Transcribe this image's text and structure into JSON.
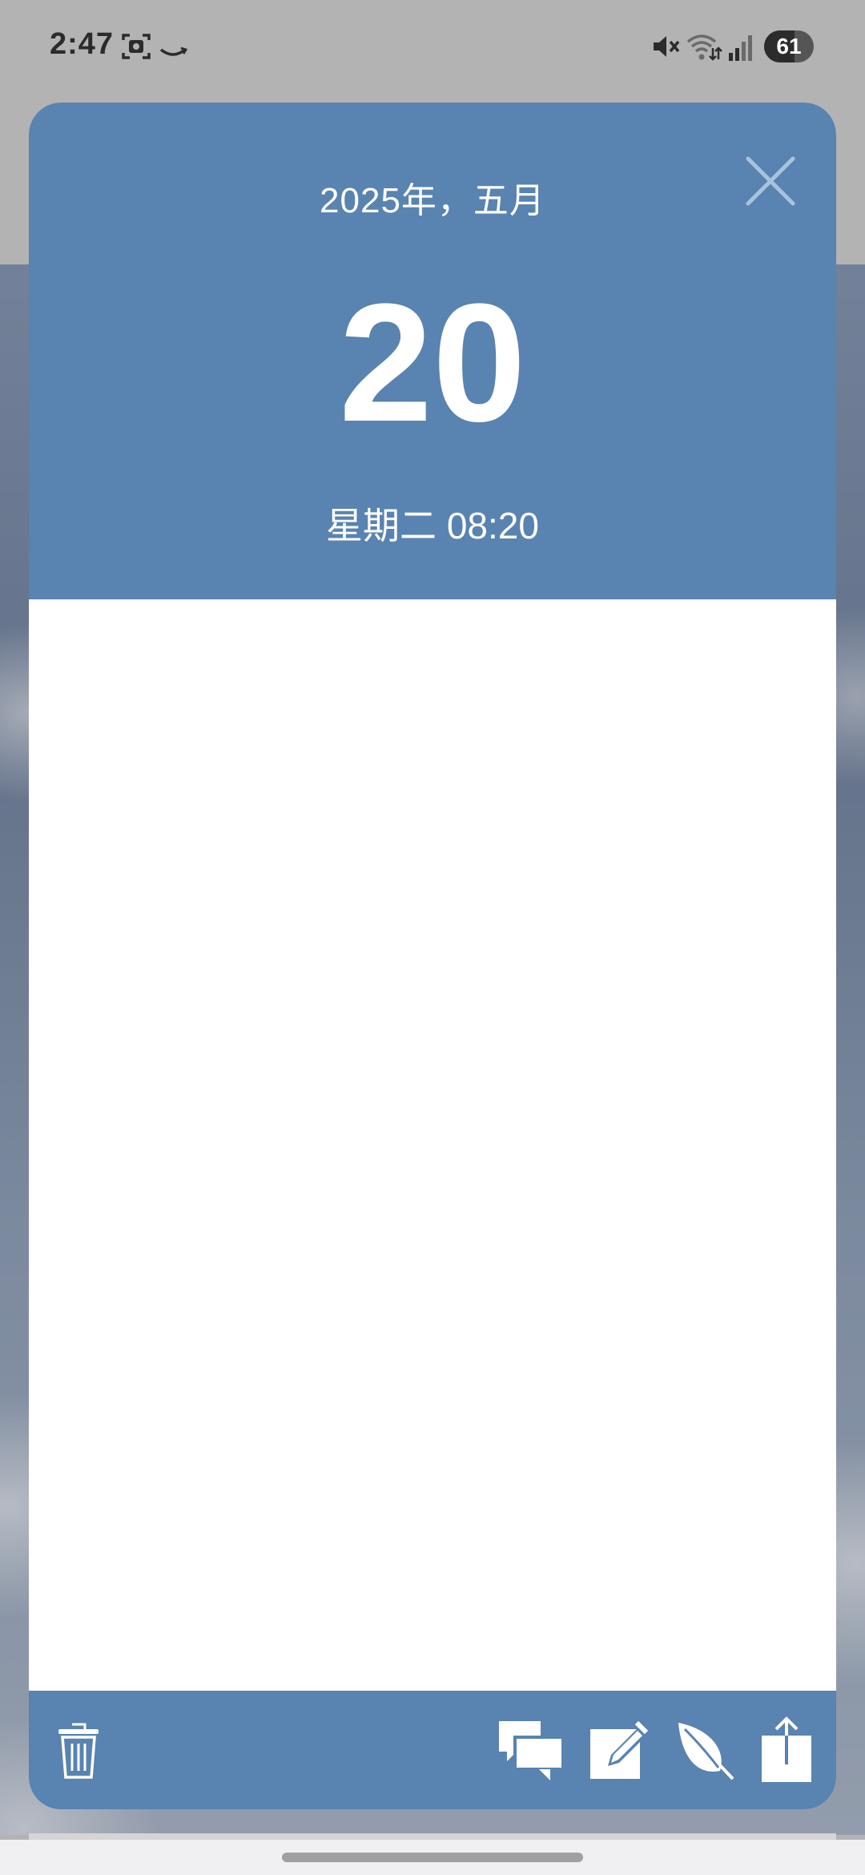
{
  "status_bar": {
    "time": "2:47",
    "battery": "61",
    "battery_level": 0.61
  },
  "calendar_dialog": {
    "year_month": "2025年，五月",
    "day": "20",
    "weekday_time": "星期二 08:20",
    "header_color": "#5983b0",
    "icons": {
      "close": "close-icon",
      "delete": "trash-icon",
      "comments": "chat-bubbles-icon",
      "edit": "edit-icon",
      "leaf": "leaf-icon",
      "share": "share-icon"
    }
  }
}
